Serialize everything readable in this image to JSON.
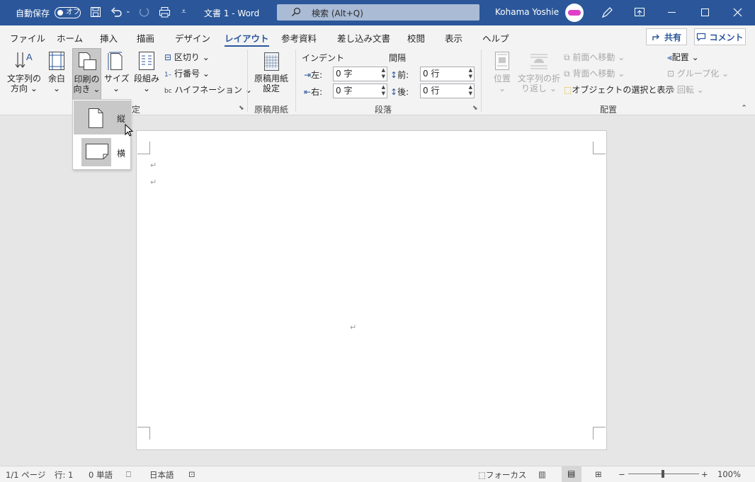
{
  "titlebar": {
    "autosave_label": "自動保存",
    "autosave_state": "オフ",
    "doc_title": "文書 1  -  Word",
    "search_label": "検索 (Alt+Q)",
    "user_name": "Kohama Yoshie"
  },
  "tabs": [
    "ファイル",
    "ホーム",
    "挿入",
    "描画",
    "デザイン",
    "レイアウト",
    "参考資料",
    "差し込み文書",
    "校閲",
    "表示",
    "ヘルプ"
  ],
  "active_tab": "レイアウト",
  "share_label": "共有",
  "comment_label": "コメント",
  "ribbon": {
    "text_direction": [
      "文字列の",
      "方向"
    ],
    "margins": "余白",
    "orientation": [
      "印刷の",
      "向き"
    ],
    "size": "サイズ",
    "columns": "段組み",
    "breaks": "区切り",
    "line_numbers": "行番号",
    "hyphenation": "ハイフネーション",
    "page_setup_group": "定",
    "genko_label": [
      "原稿用紙",
      "設定"
    ],
    "genko_group": "原稿用紙",
    "indent_label": "インデント",
    "spacing_label": "間隔",
    "indent_left_label": "左:",
    "indent_left_value": "0 字",
    "indent_right_label": "右:",
    "indent_right_value": "0 字",
    "space_before_label": "前:",
    "space_before_value": "0 行",
    "space_after_label": "後:",
    "space_after_value": "0 行",
    "paragraph_group": "段落",
    "position": "位置",
    "wrap_text": [
      "文字列の折",
      "り返し"
    ],
    "bring_forward": "前面へ移動",
    "send_backward": "背面へ移動",
    "selection_pane": "オブジェクトの選択と表示",
    "align": "配置",
    "group": "グループ化",
    "rotate": "回転",
    "arrange_group": "配置"
  },
  "orientation_menu": {
    "portrait": "縦",
    "landscape": "横"
  },
  "status": {
    "page": "1/1 ページ",
    "line": "行: 1",
    "words": "0 単語",
    "language": "日本語",
    "focus": "フォーカス",
    "zoom": "100%"
  }
}
